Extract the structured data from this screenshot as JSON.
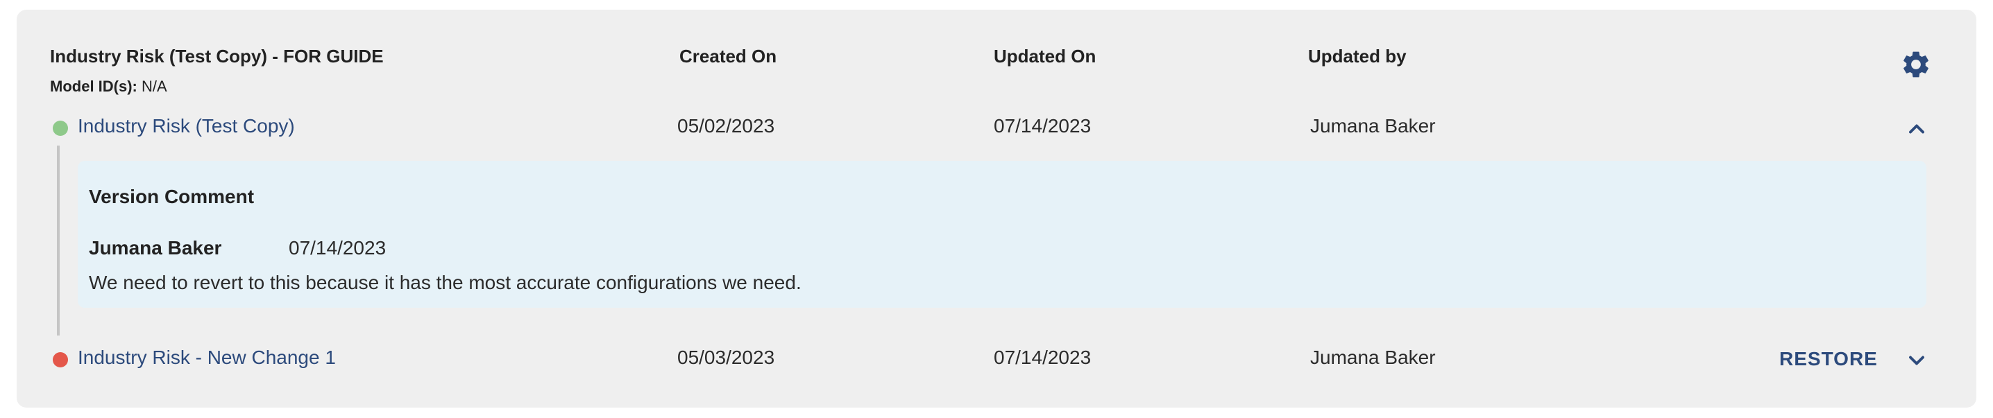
{
  "header": {
    "title": "Industry Risk (Test Copy) - FOR GUIDE",
    "col_created": "Created On",
    "col_updated": "Updated On",
    "col_updated_by": "Updated by",
    "model_id_label": "Model ID(s):",
    "model_id_value": "N/A",
    "settings_icon": "gear-icon"
  },
  "versions": [
    {
      "name": "Industry Risk (Test Copy)",
      "status_color": "#8ec98a",
      "created_on": "05/02/2023",
      "updated_on": "07/14/2023",
      "updated_by": "Jumana Baker",
      "expanded": true,
      "toggle_icon": "chevron-up-icon",
      "comment": {
        "title": "Version Comment",
        "author": "Jumana Baker",
        "date": "07/14/2023",
        "text": "We need to revert to this because it has the most accurate configurations we need."
      }
    },
    {
      "name": "Industry Risk - New Change 1",
      "status_color": "#e4574a",
      "created_on": "05/03/2023",
      "updated_on": "07/14/2023",
      "updated_by": "Jumana Baker",
      "expanded": false,
      "action_label": "RESTORE",
      "toggle_icon": "chevron-down-icon"
    }
  ],
  "colors": {
    "card_bg": "#efefef",
    "accent": "#2c4a7c",
    "comment_bg": "#e6f2f8"
  }
}
